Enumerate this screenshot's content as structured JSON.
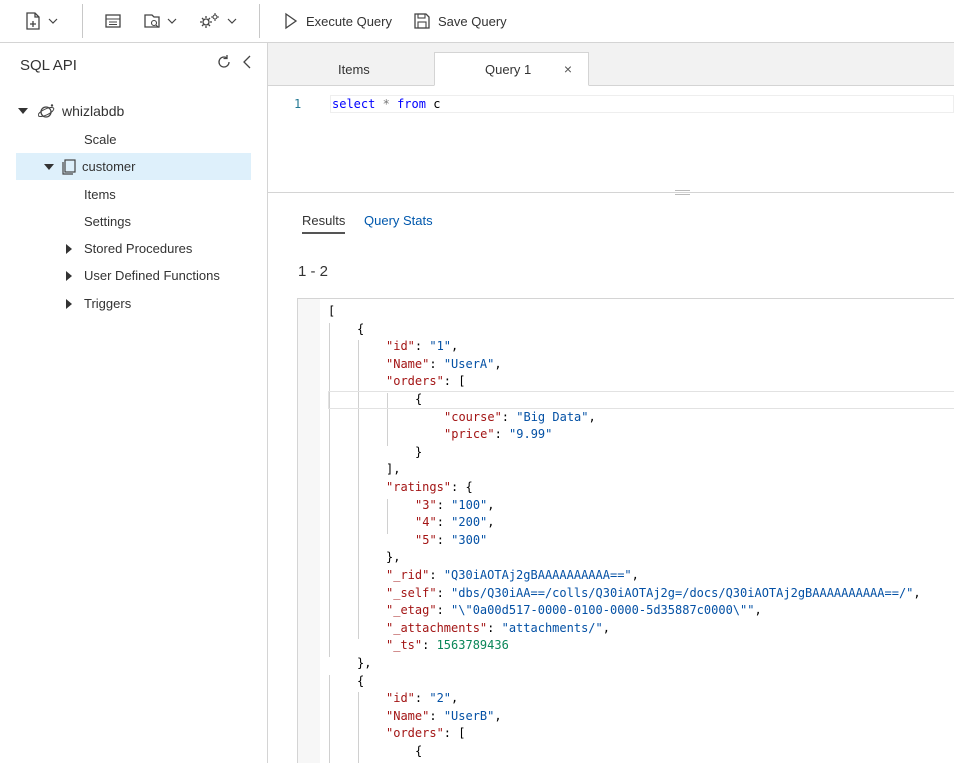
{
  "toolbar": {
    "execute_label": "Execute Query",
    "save_label": "Save Query"
  },
  "panel": {
    "title": "SQL API"
  },
  "tree": {
    "database": "whizlabdb",
    "scale": "Scale",
    "container": "customer",
    "items": "Items",
    "settings": "Settings",
    "stored_procedures": "Stored Procedures",
    "udfs": "User Defined Functions",
    "triggers": "Triggers"
  },
  "tabs": [
    {
      "label": "Items"
    },
    {
      "label": "Query 1",
      "close": "×"
    }
  ],
  "editor": {
    "line_number": "1",
    "kw1": "select",
    "star": "*",
    "kw2": "from",
    "alias": "c"
  },
  "results": {
    "tabs": [
      "Results",
      "Query Stats"
    ],
    "range": "1 - 2"
  },
  "json_lines": [
    [
      {
        "t": "p",
        "v": "["
      }
    ],
    [
      {
        "t": "p",
        "v": "{"
      }
    ],
    [
      {
        "t": "k",
        "v": "\"id\""
      },
      {
        "t": "p",
        "v": ": "
      },
      {
        "t": "s",
        "v": "\"1\""
      },
      {
        "t": "p",
        "v": ","
      }
    ],
    [
      {
        "t": "k",
        "v": "\"Name\""
      },
      {
        "t": "p",
        "v": ": "
      },
      {
        "t": "s",
        "v": "\"UserA\""
      },
      {
        "t": "p",
        "v": ","
      }
    ],
    [
      {
        "t": "k",
        "v": "\"orders\""
      },
      {
        "t": "p",
        "v": ": ["
      }
    ],
    [
      {
        "t": "p",
        "v": "{"
      }
    ],
    [
      {
        "t": "k",
        "v": "\"course\""
      },
      {
        "t": "p",
        "v": ": "
      },
      {
        "t": "s",
        "v": "\"Big Data\""
      },
      {
        "t": "p",
        "v": ","
      }
    ],
    [
      {
        "t": "k",
        "v": "\"price\""
      },
      {
        "t": "p",
        "v": ": "
      },
      {
        "t": "s",
        "v": "\"9.99\""
      }
    ],
    [
      {
        "t": "p",
        "v": "}"
      }
    ],
    [
      {
        "t": "p",
        "v": "],"
      }
    ],
    [
      {
        "t": "k",
        "v": "\"ratings\""
      },
      {
        "t": "p",
        "v": ": {"
      }
    ],
    [
      {
        "t": "k",
        "v": "\"3\""
      },
      {
        "t": "p",
        "v": ": "
      },
      {
        "t": "s",
        "v": "\"100\""
      },
      {
        "t": "p",
        "v": ","
      }
    ],
    [
      {
        "t": "k",
        "v": "\"4\""
      },
      {
        "t": "p",
        "v": ": "
      },
      {
        "t": "s",
        "v": "\"200\""
      },
      {
        "t": "p",
        "v": ","
      }
    ],
    [
      {
        "t": "k",
        "v": "\"5\""
      },
      {
        "t": "p",
        "v": ": "
      },
      {
        "t": "s",
        "v": "\"300\""
      }
    ],
    [
      {
        "t": "p",
        "v": "},"
      }
    ],
    [
      {
        "t": "k",
        "v": "\"_rid\""
      },
      {
        "t": "p",
        "v": ": "
      },
      {
        "t": "s",
        "v": "\"Q30iAOTAj2gBAAAAAAAAAA==\""
      },
      {
        "t": "p",
        "v": ","
      }
    ],
    [
      {
        "t": "k",
        "v": "\"_self\""
      },
      {
        "t": "p",
        "v": ": "
      },
      {
        "t": "s",
        "v": "\"dbs/Q30iAA==/colls/Q30iAOTAj2g=/docs/Q30iAOTAj2gBAAAAAAAAAA==/\""
      },
      {
        "t": "p",
        "v": ","
      }
    ],
    [
      {
        "t": "k",
        "v": "\"_etag\""
      },
      {
        "t": "p",
        "v": ": "
      },
      {
        "t": "s",
        "v": "\"\\\"0a00d517-0000-0100-0000-5d35887c0000\\\"\""
      },
      {
        "t": "p",
        "v": ","
      }
    ],
    [
      {
        "t": "k",
        "v": "\"_attachments\""
      },
      {
        "t": "p",
        "v": ": "
      },
      {
        "t": "s",
        "v": "\"attachments/\""
      },
      {
        "t": "p",
        "v": ","
      }
    ],
    [
      {
        "t": "k",
        "v": "\"_ts\""
      },
      {
        "t": "p",
        "v": ": "
      },
      {
        "t": "n",
        "v": "1563789436"
      }
    ],
    [
      {
        "t": "p",
        "v": "},"
      }
    ],
    [
      {
        "t": "p",
        "v": "{"
      }
    ],
    [
      {
        "t": "k",
        "v": "\"id\""
      },
      {
        "t": "p",
        "v": ": "
      },
      {
        "t": "s",
        "v": "\"2\""
      },
      {
        "t": "p",
        "v": ","
      }
    ],
    [
      {
        "t": "k",
        "v": "\"Name\""
      },
      {
        "t": "p",
        "v": ": "
      },
      {
        "t": "s",
        "v": "\"UserB\""
      },
      {
        "t": "p",
        "v": ","
      }
    ],
    [
      {
        "t": "k",
        "v": "\"orders\""
      },
      {
        "t": "p",
        "v": ": ["
      }
    ],
    [
      {
        "t": "p",
        "v": "{"
      }
    ]
  ]
}
